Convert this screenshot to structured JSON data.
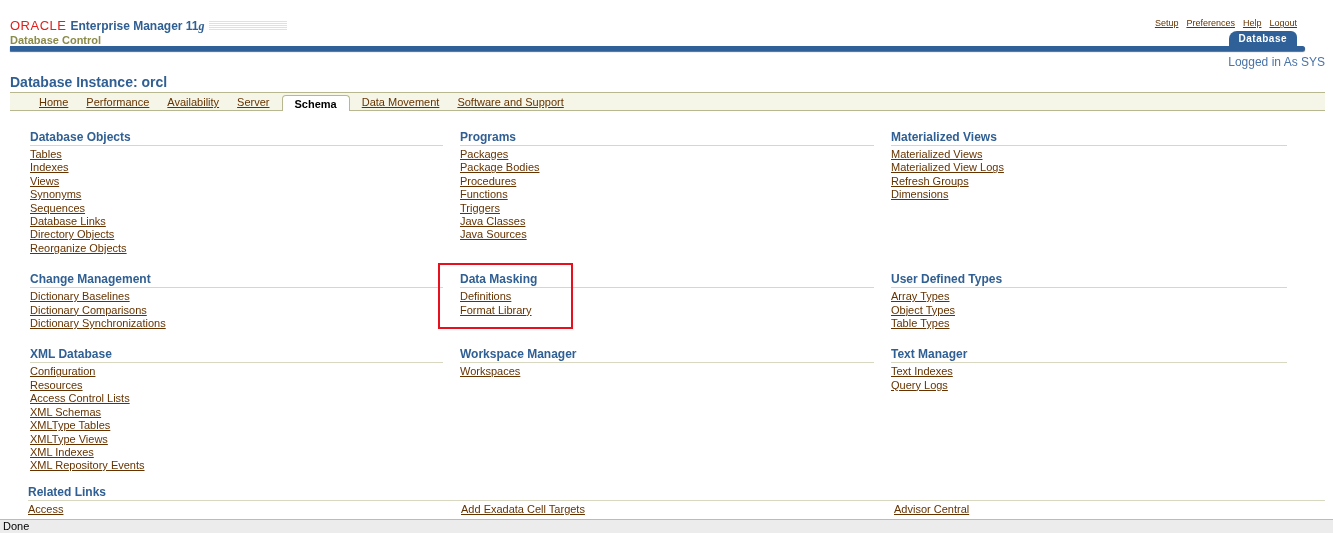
{
  "header": {
    "brand": "ORACLE",
    "product": "Enterprise Manager 11",
    "product_suffix": "g",
    "subtitle": "Database Control",
    "global_links": [
      "Setup",
      "Preferences",
      "Help",
      "Logout"
    ],
    "context_tab": "Database",
    "login_info": "Logged in As SYS"
  },
  "page_title": "Database Instance: orcl",
  "tabs": [
    {
      "label": "Home",
      "selected": false
    },
    {
      "label": "Performance",
      "selected": false
    },
    {
      "label": "Availability",
      "selected": false
    },
    {
      "label": "Server",
      "selected": false
    },
    {
      "label": "Schema",
      "selected": true
    },
    {
      "label": "Data Movement",
      "selected": false
    },
    {
      "label": "Software and Support",
      "selected": false
    }
  ],
  "sections": [
    {
      "title": "Database Objects",
      "highlighted": false,
      "links": [
        "Tables",
        "Indexes",
        "Views",
        "Synonyms",
        "Sequences",
        "Database Links",
        "Directory Objects",
        "Reorganize Objects"
      ]
    },
    {
      "title": "Programs",
      "highlighted": false,
      "links": [
        "Packages",
        "Package Bodies",
        "Procedures",
        "Functions",
        "Triggers",
        "Java Classes",
        "Java Sources"
      ]
    },
    {
      "title": "Materialized Views",
      "highlighted": false,
      "links": [
        "Materialized Views",
        "Materialized View Logs",
        "Refresh Groups",
        "Dimensions"
      ]
    },
    {
      "title": "Change Management",
      "highlighted": false,
      "links": [
        "Dictionary Baselines",
        "Dictionary Comparisons",
        "Dictionary Synchronizations"
      ]
    },
    {
      "title": "Data Masking",
      "highlighted": true,
      "links": [
        "Definitions",
        "Format Library"
      ]
    },
    {
      "title": "User Defined Types",
      "highlighted": false,
      "links": [
        "Array Types",
        "Object Types",
        "Table Types"
      ]
    },
    {
      "title": "XML Database",
      "highlighted": false,
      "links": [
        "Configuration",
        "Resources",
        "Access Control Lists",
        "XML Schemas",
        "XMLType Tables",
        "XMLType Views",
        "XML Indexes",
        "XML Repository Events"
      ]
    },
    {
      "title": "Workspace Manager",
      "highlighted": false,
      "links": [
        "Workspaces"
      ]
    },
    {
      "title": "Text Manager",
      "highlighted": false,
      "links": [
        "Text Indexes",
        "Query Logs"
      ]
    }
  ],
  "related_links": {
    "title": "Related Links",
    "links": [
      "Access",
      "Add Exadata Cell Targets",
      "Advisor Central"
    ]
  },
  "status_bar": "Done"
}
